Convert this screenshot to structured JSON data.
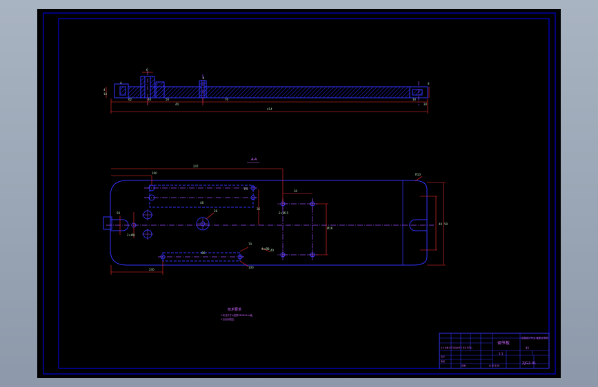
{
  "colors": {
    "frame": "#0000ff",
    "outline": "#3333ff",
    "hatch": "#2a2aff",
    "centerline": "#9a4aff",
    "dimension": "#ff3030",
    "text": "#cc66ff",
    "dimtext": "#b8e0b8",
    "background": "#000000",
    "desktop": "#9aa6b5"
  },
  "section_view": {
    "dims": [
      "4",
      "62",
      "40",
      "50",
      "14",
      "6",
      "4",
      "70",
      "40",
      "30",
      "414",
      "30",
      "8",
      "4"
    ]
  },
  "plan_view": {
    "view_label": "A-A",
    "dims": [
      "247",
      "100",
      "48",
      "30",
      "240",
      "36",
      "2×Ø15",
      "R10",
      "40",
      "50",
      "Ø6",
      "28",
      "70",
      "100",
      "40",
      "50",
      "2×Ø8",
      "4×Ø8",
      "Ø16",
      "R5"
    ]
  },
  "notes": {
    "title": "技术要求",
    "lines": [
      "1.未注尺寸公差按GB1804-m级。",
      "2.去毛刺锐边。"
    ]
  },
  "title_block": {
    "part_name": "调节板",
    "material": "45",
    "company": "机械设计专业 某职业学院",
    "scale": "1:1",
    "drawing_no": "ZJG2-01",
    "standard": "标记 处数 分区 更改文件号 签名 年月日",
    "designer": "设计",
    "checker": "审核",
    "approval": "批准",
    "weight": "共 张 第 张"
  }
}
